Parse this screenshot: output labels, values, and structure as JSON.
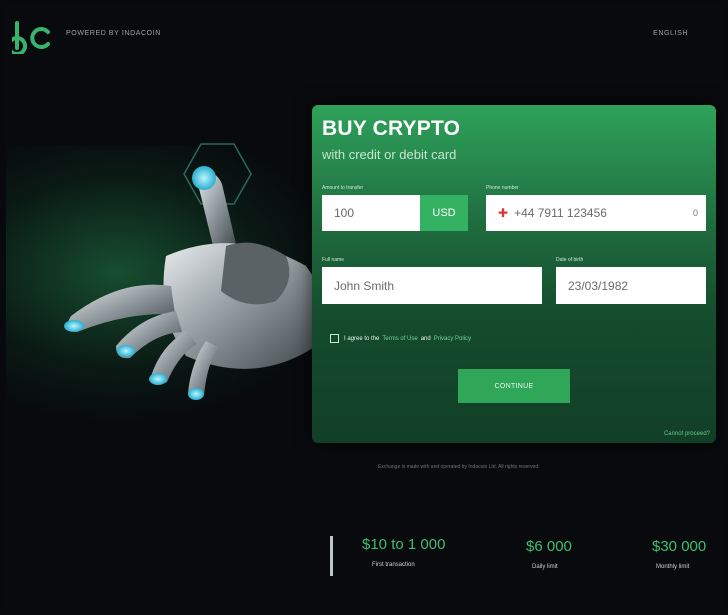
{
  "header": {
    "logo_text": "bc",
    "powered_by": "POWERED BY INDACOIN",
    "language": "ENGLISH"
  },
  "card": {
    "title": "BUY CRYPTO",
    "subtitle": "with credit or debit card",
    "amount_label": "Amount to transfer",
    "amount_value": "100",
    "currency": "USD",
    "phone_label": "Phone number",
    "phone_value": "+44 7911 123456",
    "phone_suffix": "0",
    "name_label": "Full name",
    "name_value": "John Smith",
    "dob_label": "Date of birth",
    "dob_value": "23/03/1982",
    "agree_prefix": "I agree to the",
    "terms_link": "Terms of Use",
    "agree_and": "and",
    "privacy_link": "Privacy Policy",
    "continue_label": "CONTINUE",
    "cannot_link": "Cannot proceed?"
  },
  "disclaimer": "Exchange is made with and operated by Indacoin Ltd. All rights reserved.",
  "stats": [
    {
      "value": "$10 to 1 000",
      "label": "First transaction"
    },
    {
      "value": "$6 000",
      "label": "Daily limit"
    },
    {
      "value": "$30 000",
      "label": "Monthly limit"
    }
  ],
  "colors": {
    "background": "#080a0d",
    "accent": "#2fa658",
    "stat_green": "#3fbf6a"
  }
}
